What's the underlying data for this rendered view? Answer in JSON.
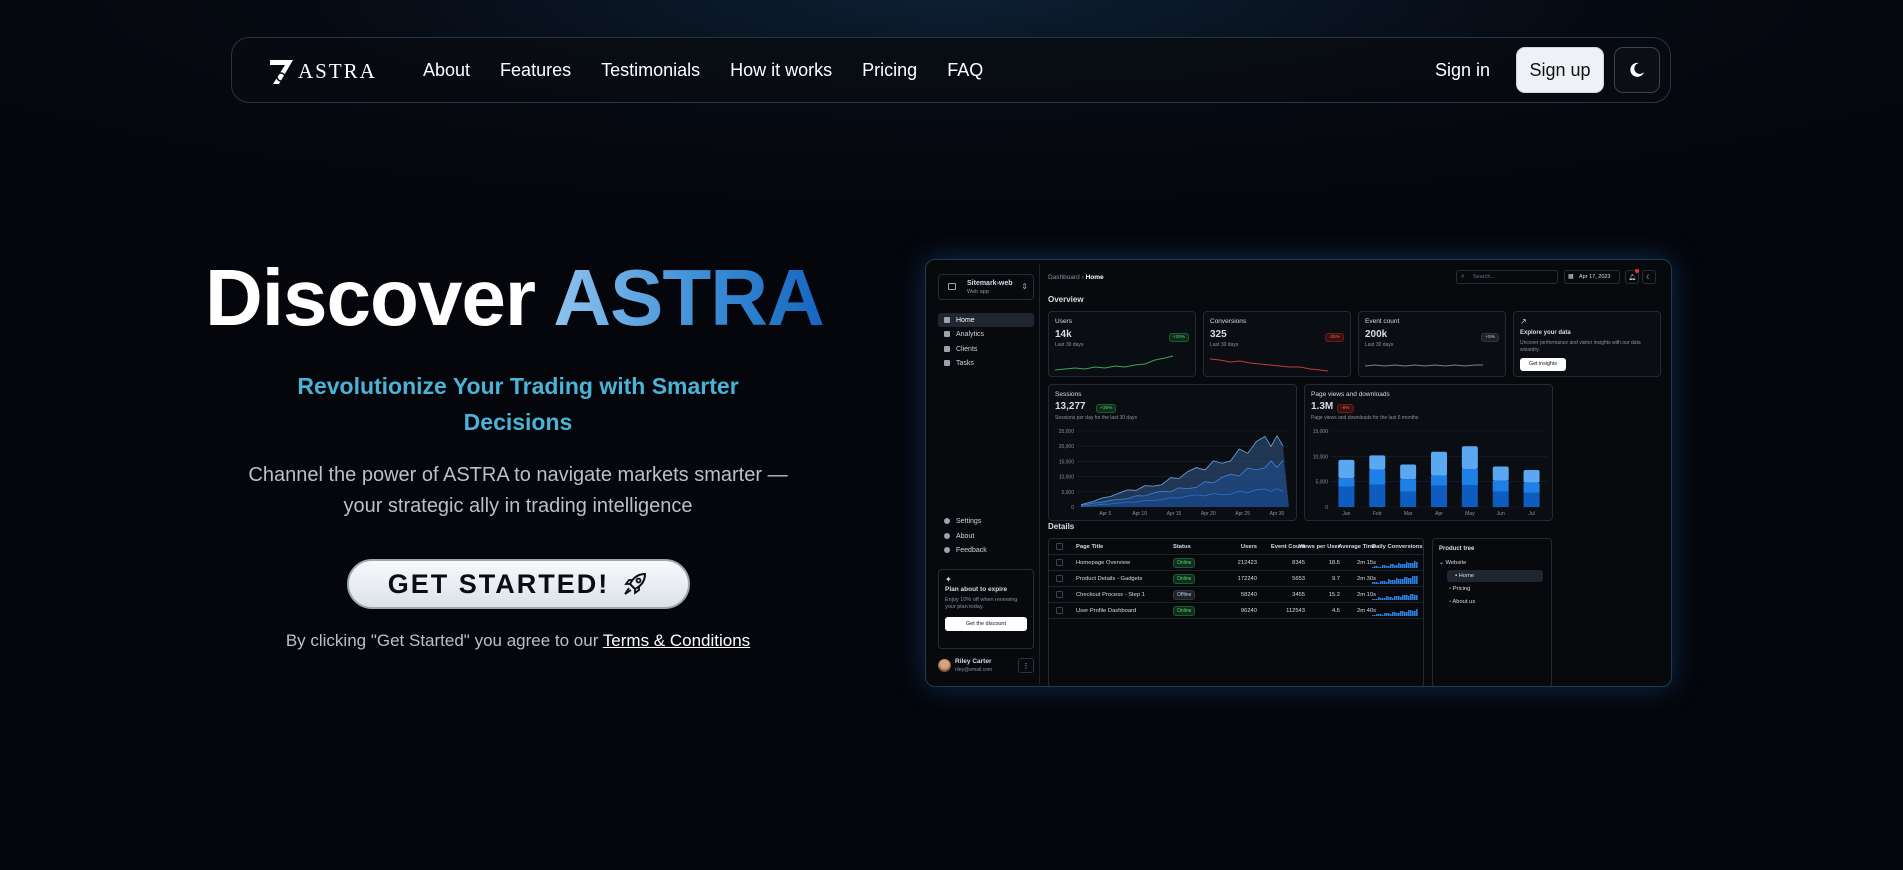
{
  "nav": {
    "logo_text": "ASTRA",
    "links": [
      "About",
      "Features",
      "Testimonials",
      "How it works",
      "Pricing",
      "FAQ"
    ],
    "signin": "Sign in",
    "signup": "Sign up"
  },
  "hero": {
    "title_prefix": "Discover",
    "title_brand": "ASTRA",
    "subtitle": "Revolutionize Your Trading with Smarter Decisions",
    "description": "Channel the power of ASTRA to navigate markets smarter — your strategic ally in trading intelligence",
    "cta": "GET STARTED!",
    "terms_prefix": "By clicking \"Get Started\" you agree to our",
    "terms_link": "Terms & Conditions"
  },
  "colors": {
    "accent": "#4ab3d6",
    "brand_gradient_start": "#8fc3ee",
    "brand_gradient_end": "#1565c0",
    "bg": "#04060b"
  },
  "dashboard": {
    "site": {
      "name": "Sitemark-web",
      "sub": "Web app"
    },
    "nav": [
      "Home",
      "Analytics",
      "Clients",
      "Tasks"
    ],
    "nav_bottom": [
      "Settings",
      "About",
      "Feedback"
    ],
    "plan": {
      "title": "Plan about to expire",
      "desc": "Enjoy 10% off when renewing your plan today.",
      "button": "Get the discount"
    },
    "user": {
      "name": "Riley Carter",
      "email": "riley@email.com"
    },
    "breadcrumb": {
      "root": "Dashboard",
      "current": "Home"
    },
    "search_placeholder": "Search...",
    "date": "Apr 17, 2023",
    "overview": "Overview",
    "cards": [
      {
        "title": "Users",
        "value": "14k",
        "sub": "Last 30 days",
        "badge": "+25%"
      },
      {
        "title": "Conversions",
        "value": "325",
        "sub": "Last 30 days",
        "badge": "-25%"
      },
      {
        "title": "Event count",
        "value": "200k",
        "sub": "Last 30 days",
        "badge": "+5%"
      }
    ],
    "insight": {
      "title": "Explore your data",
      "desc": "Uncover performance and visitor insights with our data wizardry.",
      "button": "Get insights"
    },
    "sessions": {
      "title": "Sessions",
      "value": "13,277",
      "badge": "+35%",
      "sub": "Sessions per day for the last 30 days"
    },
    "pageviews": {
      "title": "Page views and downloads",
      "value": "1.3M",
      "badge": "-8%",
      "sub": "Page views and downloads for the last 6 months"
    },
    "details": "Details",
    "table_headers": [
      "Page Title",
      "Status",
      "Users",
      "Event Count",
      "Views per User",
      "Average Time",
      "Daily Conversions"
    ],
    "table_rows": [
      {
        "title": "Homepage Overview",
        "status": "Online",
        "users": "212423",
        "events": "8345",
        "vpu": "18.5",
        "time": "2m 15s"
      },
      {
        "title": "Product Details - Gadgets",
        "status": "Online",
        "users": "172240",
        "events": "5653",
        "vpu": "9.7",
        "time": "2m 30s"
      },
      {
        "title": "Checkout Process - Step 1",
        "status": "Offline",
        "users": "58240",
        "events": "3455",
        "vpu": "15.2",
        "time": "2m 10s"
      },
      {
        "title": "User Profile Dashboard",
        "status": "Online",
        "users": "96240",
        "events": "112543",
        "vpu": "4.5",
        "time": "2m 40s"
      }
    ],
    "tree": {
      "title": "Product tree",
      "items": [
        "Website",
        "Home",
        "Pricing",
        "About us"
      ]
    }
  },
  "chart_data": [
    {
      "type": "area",
      "title": "Sessions",
      "x": [
        "Apr 5",
        "Apr 10",
        "Apr 15",
        "Apr 20",
        "Apr 25",
        "Apr 30"
      ],
      "ylim": [
        0,
        25000
      ],
      "yticks": [
        "25,000",
        "20,000",
        "15,000",
        "10,000",
        "5,000",
        "0"
      ],
      "series": [
        {
          "values": [
            2000,
            5200,
            8000,
            12000,
            16500,
            21500
          ]
        },
        {
          "values": [
            1200,
            3000,
            4800,
            7000,
            10000,
            14000
          ]
        },
        {
          "values": [
            600,
            1500,
            2600,
            3700,
            4600,
            5500
          ]
        }
      ]
    },
    {
      "type": "bar",
      "title": "Page views and downloads",
      "categories": [
        "Jan",
        "Feb",
        "Mar",
        "Apr",
        "May",
        "Jun",
        "Jul"
      ],
      "ylim": [
        0,
        15000
      ],
      "yticks": [
        "15,000",
        "10,000",
        "5,000",
        "0"
      ],
      "series": [
        {
          "values": [
            4000,
            4400,
            3000,
            4200,
            4300,
            3000,
            2800
          ]
        },
        {
          "values": [
            1700,
            3000,
            2500,
            2000,
            3200,
            2200,
            2000
          ]
        },
        {
          "values": [
            3600,
            2800,
            2900,
            4700,
            4500,
            2800,
            2500
          ]
        }
      ]
    }
  ]
}
